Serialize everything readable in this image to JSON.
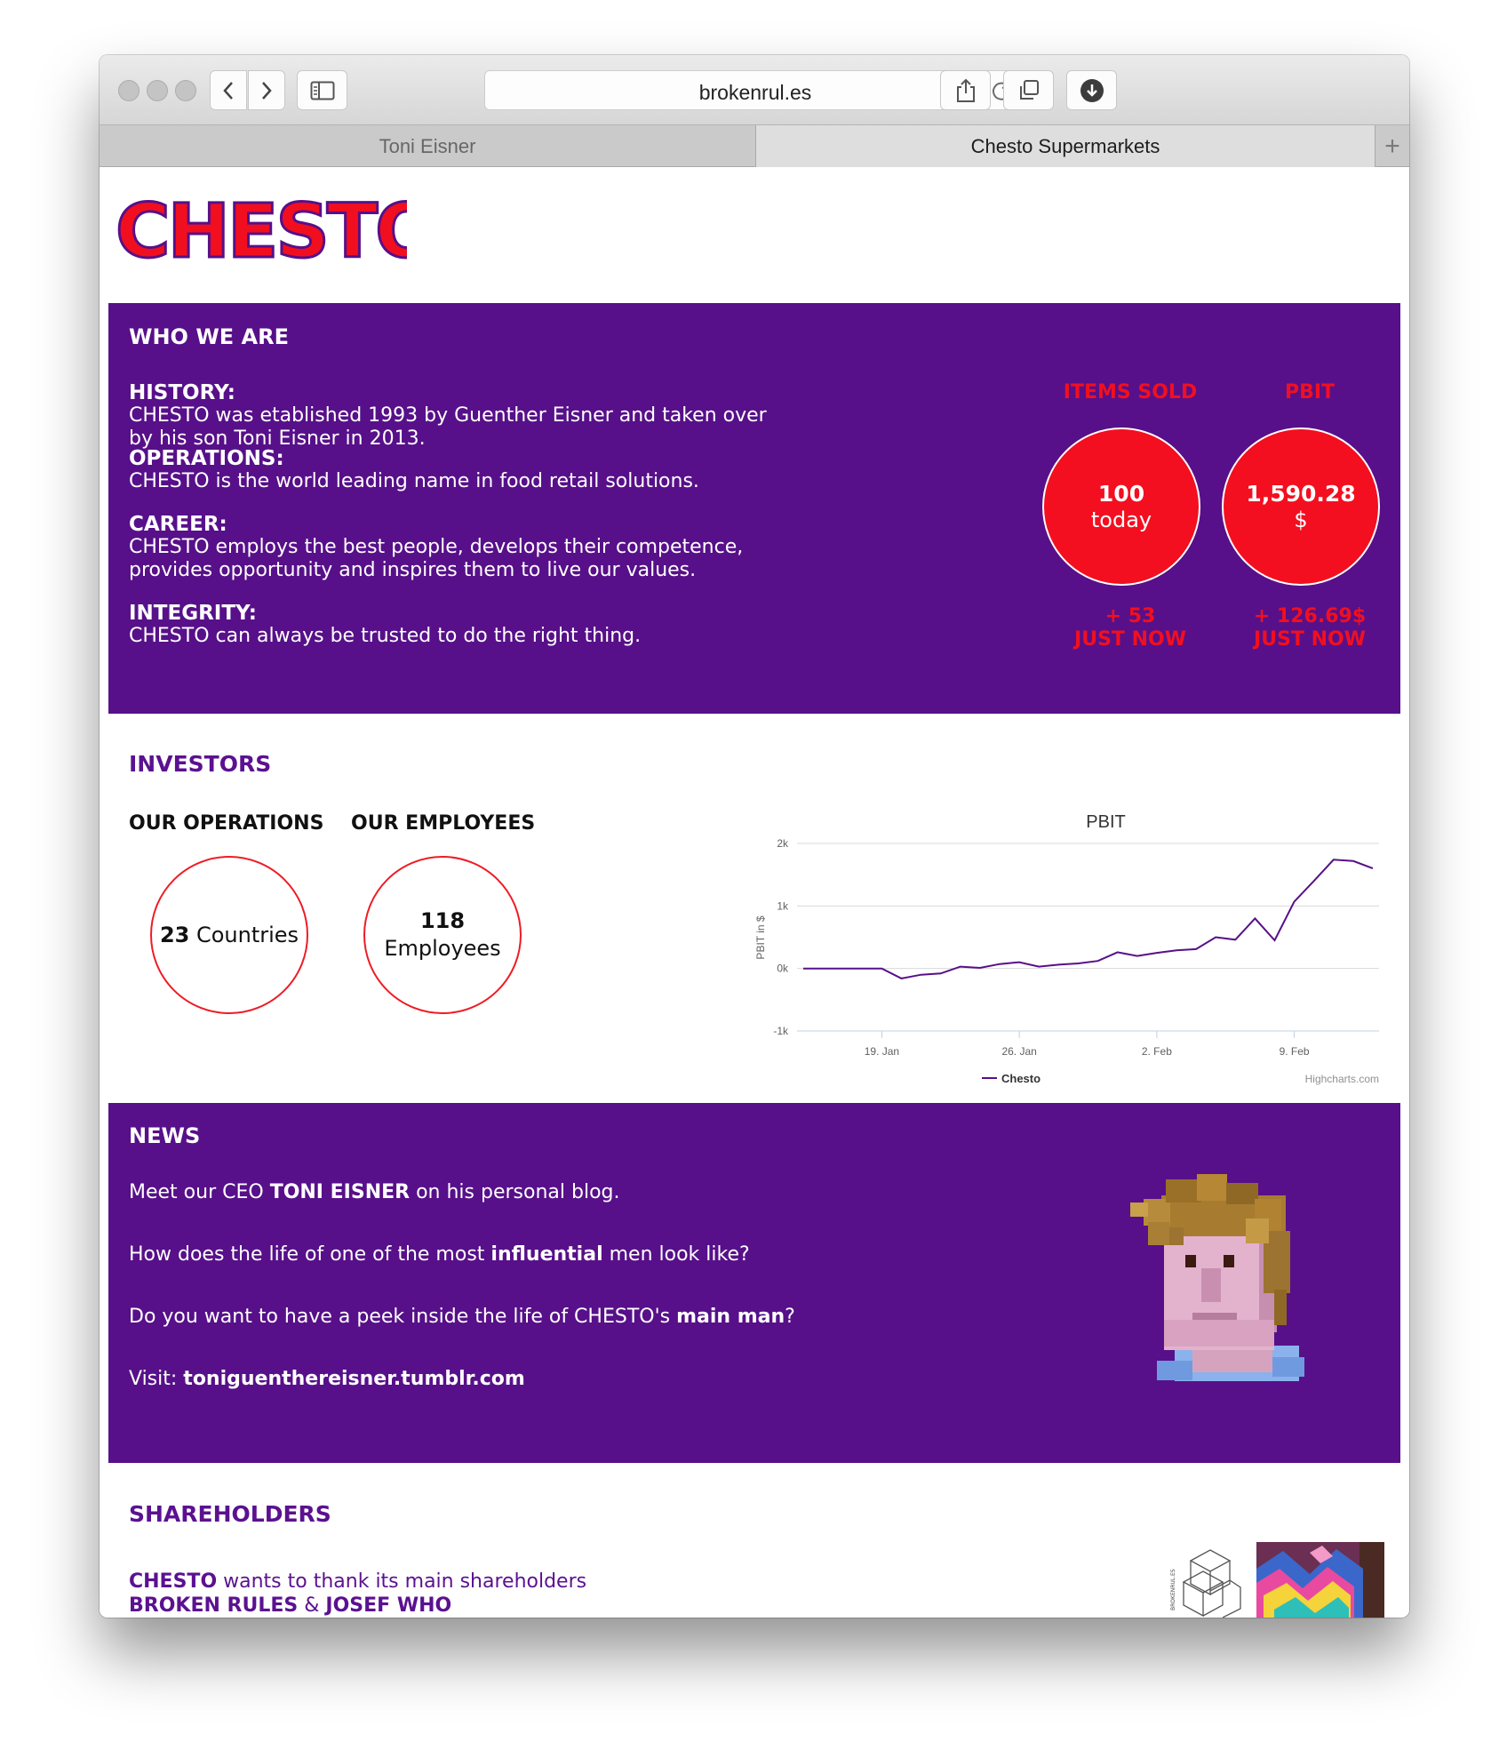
{
  "browser": {
    "url": "brokenrul.es",
    "tabs": [
      "Toni Eisner",
      "Chesto Supermarkets"
    ],
    "new_tab": "+"
  },
  "brand": {
    "logo_text": "CHESTO",
    "purple": "#571089",
    "red": "#f10f1f"
  },
  "who": {
    "title": "WHO WE ARE",
    "blocks": [
      {
        "heading": "HISTORY:",
        "text": [
          "CHESTO was etablished 1993 by Guenther Eisner and taken over",
          "by his son Toni Eisner in 2013."
        ]
      },
      {
        "heading": "OPERATIONS:",
        "text": [
          "CHESTO is the world leading name in food retail solutions."
        ]
      },
      {
        "heading": "CAREER:",
        "text": [
          "CHESTO employs the best people, develops their competence,",
          "provides opportunity and inspires them to live our values."
        ]
      },
      {
        "heading": "INTEGRITY:",
        "text": [
          "CHESTO can always be trusted to do the right thing."
        ]
      }
    ],
    "stats": [
      {
        "label": "ITEMS SOLD",
        "value": "100",
        "unit": "today",
        "change": "+ 53",
        "change_note": "JUST NOW"
      },
      {
        "label": "PBIT",
        "value": "1,590.28",
        "unit": "$",
        "change": "+ 126.69$",
        "change_note": "JUST NOW"
      }
    ]
  },
  "investors": {
    "title": "INVESTORS",
    "operations": {
      "heading": "OUR OPERATIONS",
      "value": "23",
      "label": "Countries"
    },
    "employees": {
      "heading": "OUR EMPLOYEES",
      "value": "118",
      "label": "Employees"
    }
  },
  "chart_data": {
    "type": "line",
    "title": "PBIT",
    "ylabel": "PBIT in $",
    "ylim": [
      -1000,
      2000
    ],
    "yticks": [
      "2k",
      "1k",
      "0k",
      "-1k"
    ],
    "xticks": [
      "19. Jan",
      "26. Jan",
      "2. Feb",
      "9. Feb"
    ],
    "series": [
      {
        "name": "Chesto",
        "color": "#571089",
        "x": [
          "15. Jan",
          "16. Jan",
          "17. Jan",
          "18. Jan",
          "19. Jan",
          "20. Jan",
          "21. Jan",
          "22. Jan",
          "23. Jan",
          "24. Jan",
          "25. Jan",
          "26. Jan",
          "27. Jan",
          "28. Jan",
          "29. Jan",
          "30. Jan",
          "31. Jan",
          "1. Feb",
          "2. Feb",
          "3. Feb",
          "4. Feb",
          "5. Feb",
          "6. Feb",
          "7. Feb",
          "8. Feb",
          "9. Feb",
          "10. Feb",
          "11. Feb",
          "12. Feb",
          "13. Feb"
        ],
        "values": [
          0,
          0,
          0,
          0,
          0,
          -160,
          -100,
          -80,
          30,
          10,
          70,
          100,
          30,
          60,
          80,
          120,
          260,
          200,
          250,
          290,
          310,
          500,
          460,
          800,
          450,
          1070,
          1400,
          1740,
          1720,
          1600
        ]
      }
    ],
    "legend": "bottom-center",
    "credit": "Highcharts.com",
    "grid": true
  },
  "news": {
    "title": "NEWS",
    "line1": {
      "pre": "Meet our CEO ",
      "bold": "TONI EISNER",
      "post": " on his personal blog."
    },
    "line2": {
      "pre": "How does the life of one of the most ",
      "bold": "influential",
      "post": " men look like?"
    },
    "line3": {
      "pre": "Do you want to have a peek inside the life of CHESTO's ",
      "bold": "main man",
      "post": "?"
    },
    "line4": {
      "pre": "Visit: ",
      "bold": "toniguenthereisner.tumblr.com"
    }
  },
  "shareholders": {
    "title": "SHAREHOLDERS",
    "line1": {
      "bold": "CHESTO",
      "post": " wants to thank its main shareholders"
    },
    "line2": {
      "bold1": "BROKEN RULES",
      "mid": " & ",
      "bold2": "JOSEF WHO"
    },
    "logo_text": "BROKENRUL.ES"
  }
}
